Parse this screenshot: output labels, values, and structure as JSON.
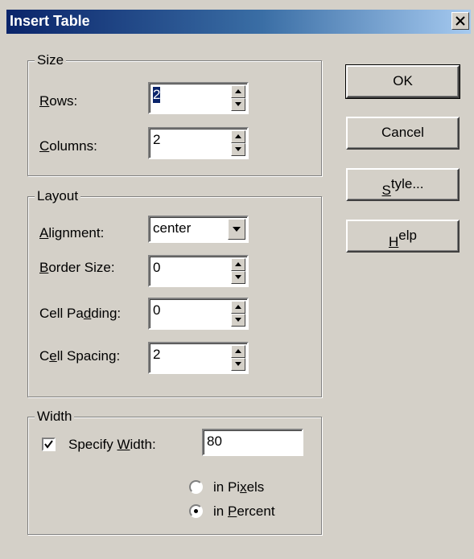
{
  "window": {
    "title": "Insert Table"
  },
  "size": {
    "legend": "Size",
    "rows_label": "Rows:",
    "rows_value": "2",
    "columns_label": "Columns:",
    "columns_value": "2"
  },
  "layout": {
    "legend": "Layout",
    "alignment_label": "Alignment:",
    "alignment_value": "center",
    "border_label": "Border Size:",
    "border_value": "0",
    "padding_label": "Cell Padding:",
    "padding_value": "0",
    "spacing_label": "Cell Spacing:",
    "spacing_value": "2"
  },
  "width": {
    "legend": "Width",
    "specify_label": "Specify Width:",
    "specify_checked": true,
    "value": "80",
    "pixels_label": "in Pixels",
    "percent_label": "in Percent",
    "selected_unit": "percent"
  },
  "buttons": {
    "ok": "OK",
    "cancel": "Cancel",
    "style": "Style...",
    "help": "Help"
  }
}
